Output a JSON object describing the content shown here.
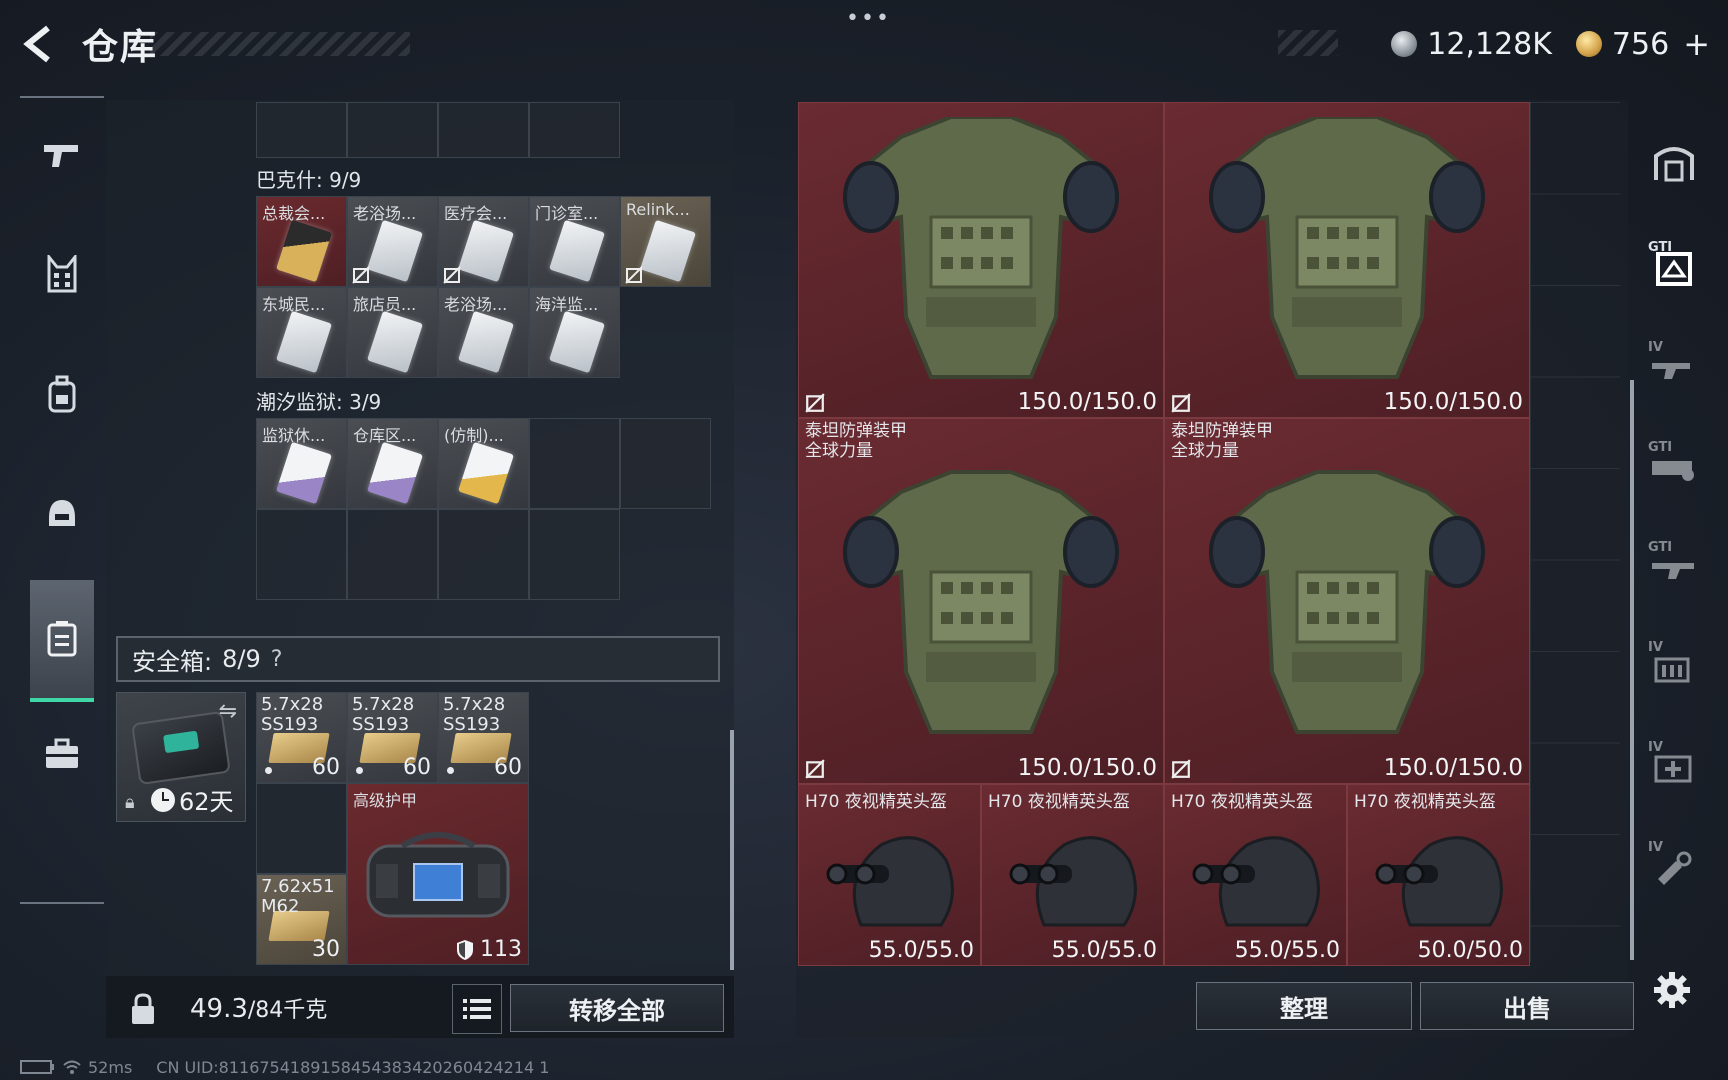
{
  "header": {
    "title": "仓库",
    "more": "•••",
    "currency": [
      {
        "icon": "silver-coin-icon",
        "value": "12,128K"
      },
      {
        "icon": "gold-coin-icon",
        "value": "756"
      }
    ],
    "add": "+"
  },
  "left_nav": [
    "weapon-icon",
    "vest-icon",
    "backpack-icon",
    "helmet-icon",
    "safebox-icon",
    "briefcase-icon"
  ],
  "key_sections": [
    {
      "title": "巴克什: 9/9",
      "items": [
        {
          "name": "总裁会...",
          "style": "gold",
          "nobag": false
        },
        {
          "name": "老浴场...",
          "style": "plain",
          "nobag": true
        },
        {
          "name": "医疗会...",
          "style": "plain",
          "nobag": true
        },
        {
          "name": "门诊室...",
          "style": "plain",
          "nobag": false
        },
        {
          "name": "Relink...",
          "style": "plain",
          "nobag": true
        },
        {
          "name": "东城民...",
          "style": "plain",
          "nobag": false
        },
        {
          "name": "旅店员...",
          "style": "plain",
          "nobag": false
        },
        {
          "name": "老浴场...",
          "style": "plain",
          "nobag": false
        },
        {
          "name": "海洋监...",
          "style": "plain",
          "nobag": false
        }
      ]
    },
    {
      "title": "潮汐监狱: 3/9",
      "items": [
        {
          "name": "监狱休...",
          "style": "purple",
          "nobag": false
        },
        {
          "name": "仓库区...",
          "style": "purple",
          "nobag": false
        },
        {
          "name": "(仿制)...",
          "style": "gold2",
          "nobag": false
        }
      ]
    }
  ],
  "safebox": {
    "label": "安全箱:",
    "count": "8/9",
    "help": "?",
    "days": "62天",
    "ammo": [
      {
        "name": "5.7x28\nSS193",
        "qty": "60"
      },
      {
        "name": "5.7x28\nSS193",
        "qty": "60"
      },
      {
        "name": "5.7x28\nSS193",
        "qty": "60"
      }
    ],
    "ammo_762": {
      "name": "7.62x51\nM62",
      "qty": "30"
    },
    "armor_bag": {
      "name": "高级护甲",
      "value": "113"
    }
  },
  "bottom_left": {
    "capacity_value": "49.3",
    "capacity_max": "/84千克",
    "transfer_all": "转移全部"
  },
  "armors": [
    {
      "name": "",
      "durability": "150.0/150.0"
    },
    {
      "name": "",
      "durability": "150.0/150.0"
    },
    {
      "name": "泰坦防弹装甲\n全球力量",
      "durability": "150.0/150.0"
    },
    {
      "name": "泰坦防弹装甲\n全球力量",
      "durability": "150.0/150.0"
    }
  ],
  "helmets": [
    {
      "name": "H70 夜视精英头盔",
      "durability": "55.0/55.0"
    },
    {
      "name": "H70 夜视精英头盔",
      "durability": "55.0/55.0"
    },
    {
      "name": "H70 夜视精英头盔",
      "durability": "55.0/55.0"
    },
    {
      "name": "H70 夜视精英头盔",
      "durability": "50.0/50.0"
    }
  ],
  "right_actions": {
    "sort": "整理",
    "sell": "出售"
  },
  "right_nav": [
    {
      "tag": "",
      "icon": "warehouse-icon"
    },
    {
      "tag": "GTI",
      "icon": "warehouse-gti-icon"
    },
    {
      "tag": "IV",
      "icon": "rifle-rack-icon"
    },
    {
      "tag": "GTI",
      "icon": "vehicle-rack-icon"
    },
    {
      "tag": "GTI",
      "icon": "weapon-rack-icon"
    },
    {
      "tag": "IV",
      "icon": "ammo-rack-icon"
    },
    {
      "tag": "IV",
      "icon": "medical-rack-icon"
    },
    {
      "tag": "IV",
      "icon": "tool-rack-icon"
    }
  ],
  "status": {
    "ping": "52ms",
    "uid": "CN UID:8116754189158454383420260424214 1"
  },
  "colors": {
    "accent": "#3fd7a5",
    "item_red": "#5b252a",
    "panel": "#1e242c"
  }
}
